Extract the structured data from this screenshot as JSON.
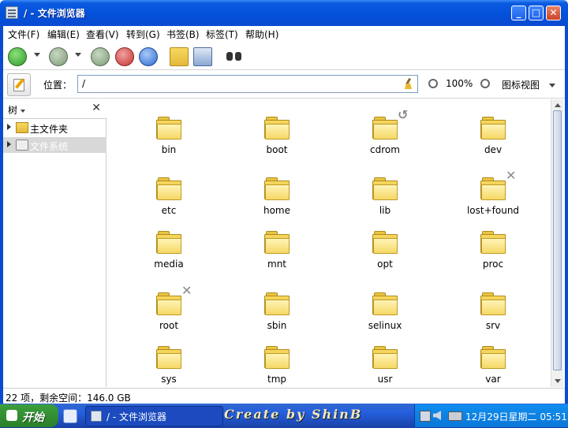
{
  "window": {
    "title": "/ - 文件浏览器"
  },
  "title_buttons": {
    "minimize": "_",
    "maximize": "□",
    "close": "✕"
  },
  "menubar": [
    "文件(F)",
    "编辑(E)",
    "查看(V)",
    "转到(G)",
    "书签(B)",
    "标签(T)",
    "帮助(H)"
  ],
  "location": {
    "label": "位置：",
    "value": "/",
    "zoom": "100%",
    "view_mode": "图标视图"
  },
  "sidebar": {
    "header": "树",
    "items": [
      {
        "label": "主文件夹",
        "icon": "home-folder-icon",
        "selected": false
      },
      {
        "label": "文件系统",
        "icon": "drive-icon",
        "selected": true
      }
    ]
  },
  "folders": [
    {
      "name": "bin",
      "emblem": ""
    },
    {
      "name": "boot",
      "emblem": ""
    },
    {
      "name": "cdrom",
      "emblem": "symlink"
    },
    {
      "name": "dev",
      "emblem": ""
    },
    {
      "name": "etc",
      "emblem": ""
    },
    {
      "name": "home",
      "emblem": ""
    },
    {
      "name": "lib",
      "emblem": ""
    },
    {
      "name": "lost+found",
      "emblem": "unreadable"
    },
    {
      "name": "media",
      "emblem": ""
    },
    {
      "name": "mnt",
      "emblem": ""
    },
    {
      "name": "opt",
      "emblem": ""
    },
    {
      "name": "proc",
      "emblem": ""
    },
    {
      "name": "root",
      "emblem": "unreadable"
    },
    {
      "name": "sbin",
      "emblem": ""
    },
    {
      "name": "selinux",
      "emblem": ""
    },
    {
      "name": "srv",
      "emblem": ""
    },
    {
      "name": "sys",
      "emblem": ""
    },
    {
      "name": "tmp",
      "emblem": ""
    },
    {
      "name": "usr",
      "emblem": ""
    },
    {
      "name": "var",
      "emblem": ""
    }
  ],
  "statusbar": {
    "text": "22 项，剩余空间：146.0 GB"
  },
  "taskbar": {
    "start_label": "开始",
    "task_label": "/ - 文件浏览器",
    "brand_text": "Create by ShinB",
    "clock": "12月29日星期二  05:51"
  }
}
